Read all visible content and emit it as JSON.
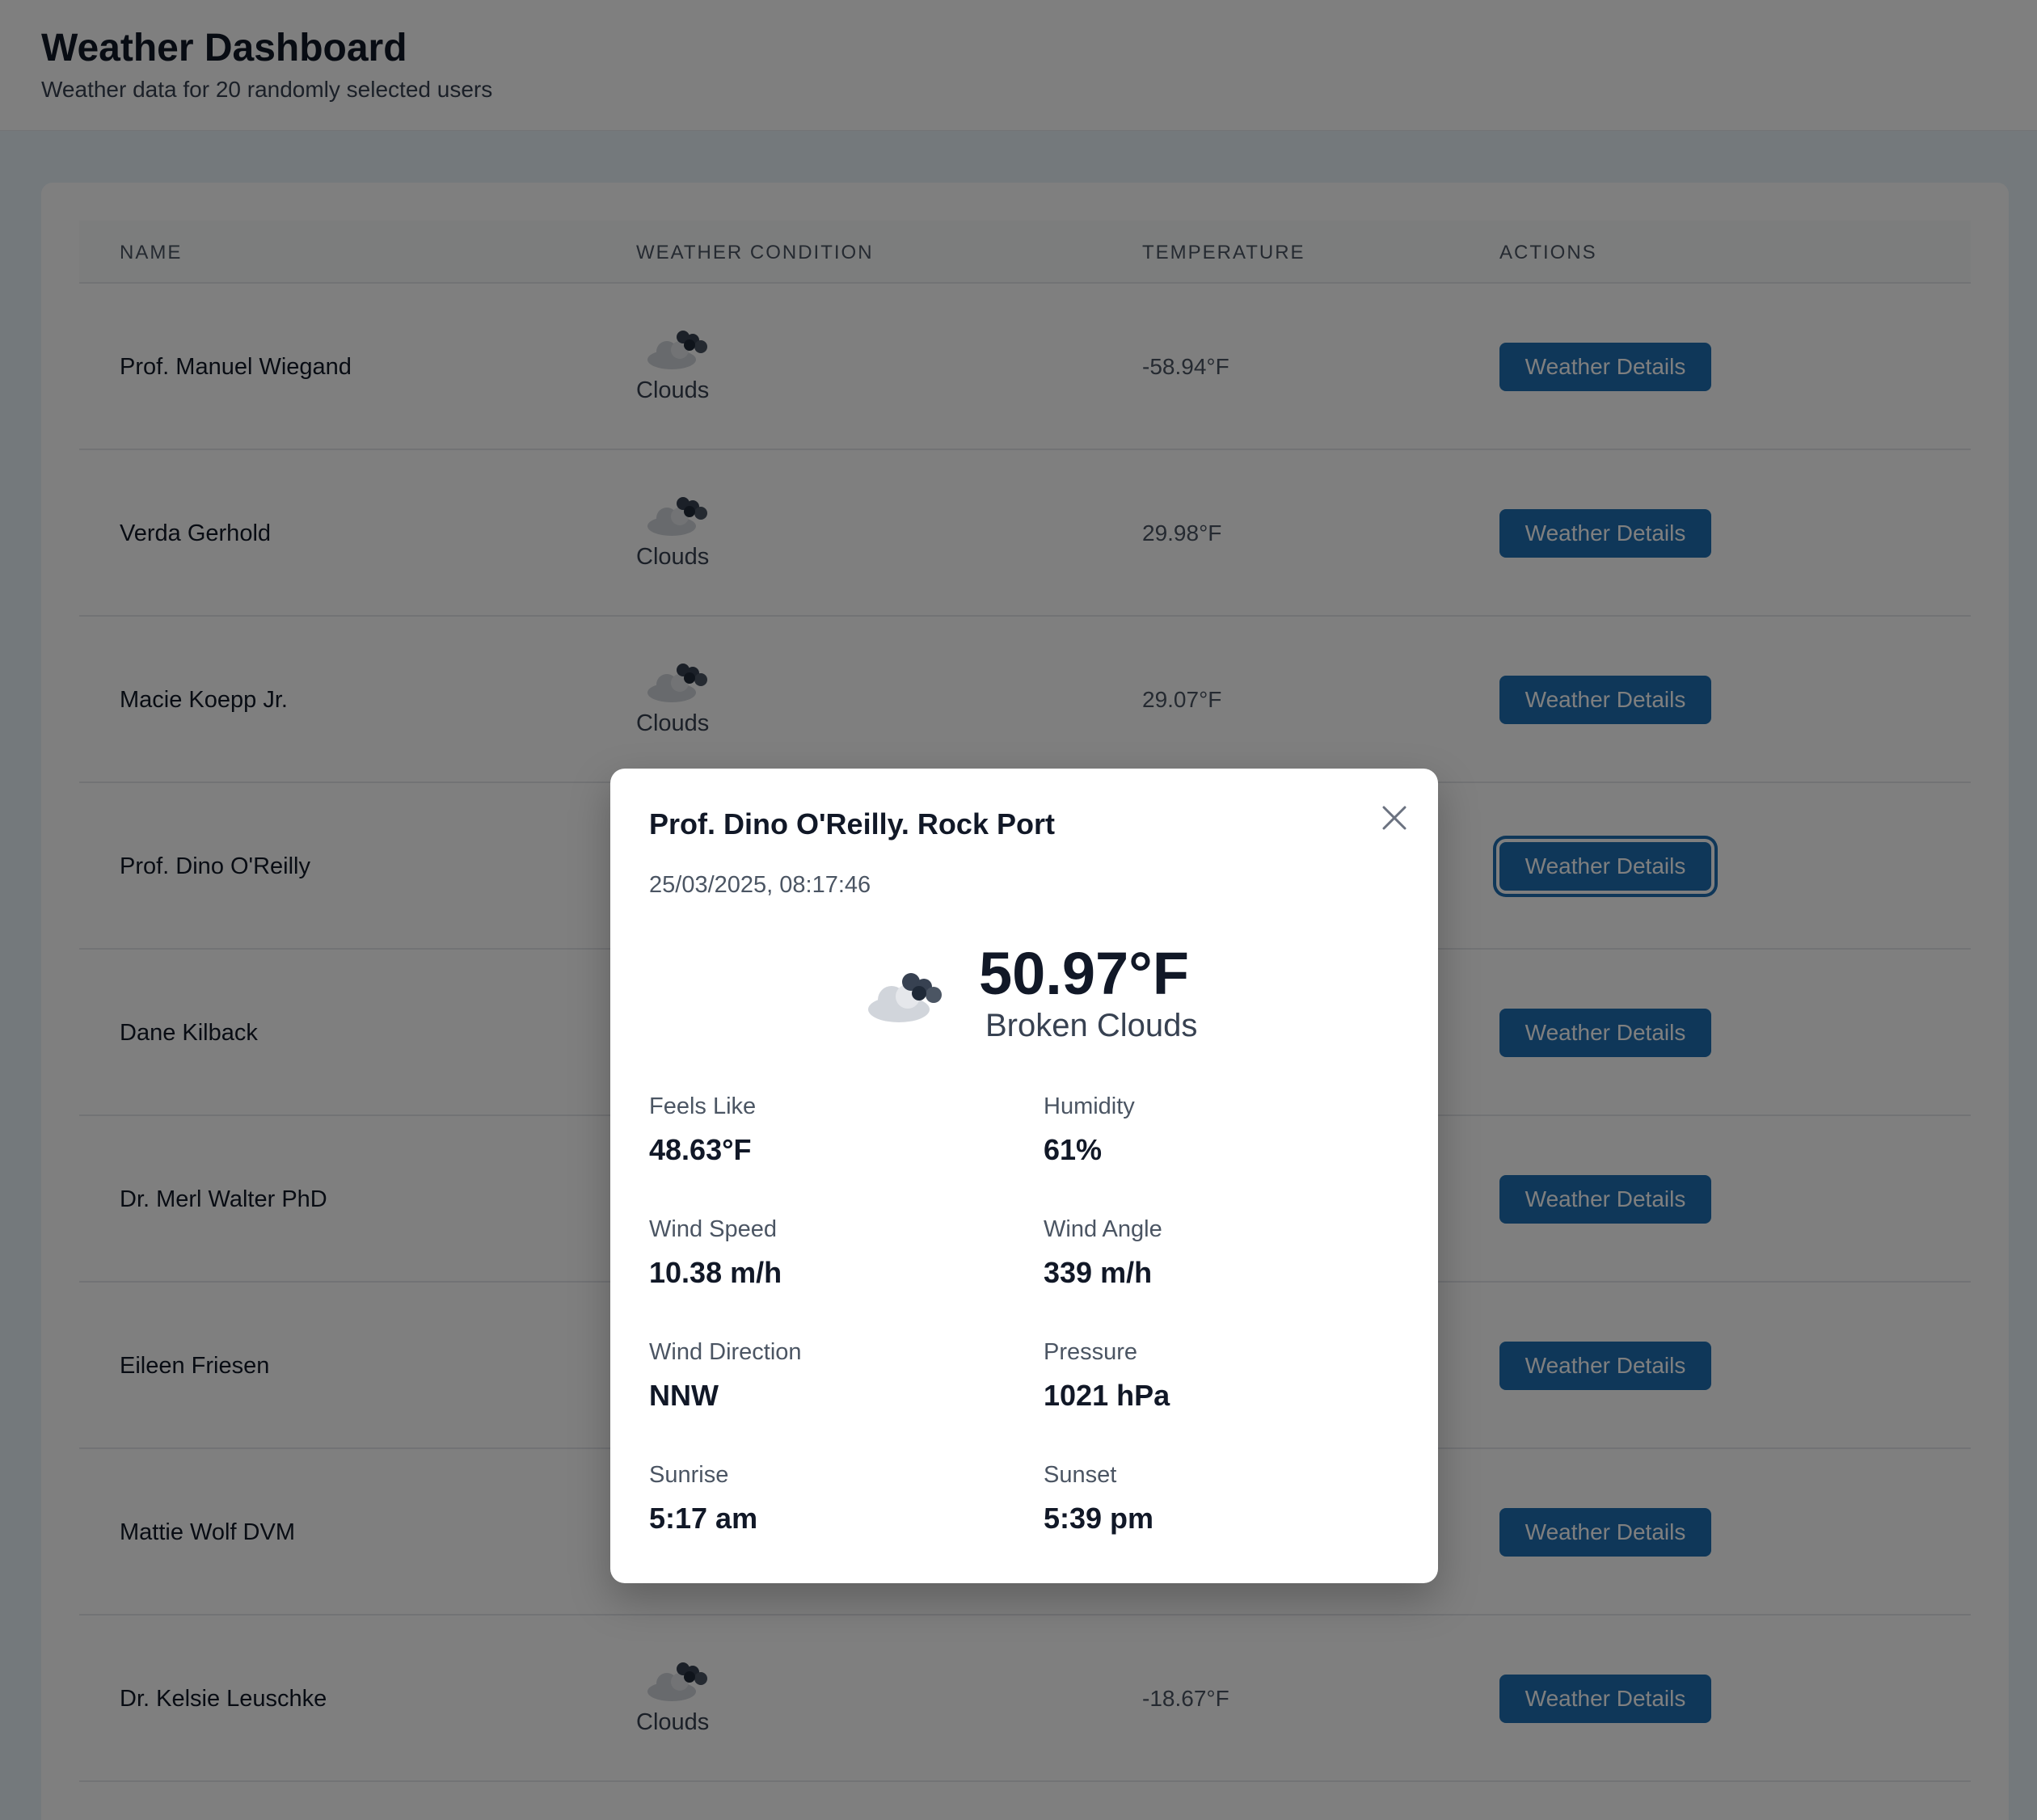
{
  "header": {
    "title": "Weather Dashboard",
    "subtitle": "Weather data for 20 randomly selected users"
  },
  "table": {
    "columns": [
      "NAME",
      "WEATHER CONDITION",
      "TEMPERATURE",
      "ACTIONS"
    ],
    "rows": [
      {
        "name": "Prof. Manuel Wiegand",
        "condition": "Clouds",
        "temperature": "-58.94°F",
        "action": "Weather Details"
      },
      {
        "name": "Verda Gerhold",
        "condition": "Clouds",
        "temperature": "29.98°F",
        "action": "Weather Details"
      },
      {
        "name": "Macie Koepp Jr.",
        "condition": "Clouds",
        "temperature": "29.07°F",
        "action": "Weather Details"
      },
      {
        "name": "Prof. Dino O'Reilly",
        "condition": "",
        "temperature": "",
        "action": "Weather Details"
      },
      {
        "name": "Dane Kilback",
        "condition": "",
        "temperature": "",
        "action": "Weather Details"
      },
      {
        "name": "Dr. Merl Walter PhD",
        "condition": "",
        "temperature": "",
        "action": "Weather Details"
      },
      {
        "name": "Eileen Friesen",
        "condition": "",
        "temperature": "",
        "action": "Weather Details"
      },
      {
        "name": "Mattie Wolf DVM",
        "condition": "",
        "temperature": "",
        "action": "Weather Details"
      },
      {
        "name": "Dr. Kelsie Leuschke",
        "condition": "Clouds",
        "temperature": "-18.67°F",
        "action": "Weather Details"
      }
    ]
  },
  "modal": {
    "title": "Prof. Dino O'Reilly. Rock Port",
    "datetime": "25/03/2025, 08:17:46",
    "temperature": "50.97°F",
    "description": "Broken Clouds",
    "icon": "broken-clouds-icon",
    "close_icon": "close-icon",
    "stats": {
      "feels_like": {
        "label": "Feels Like",
        "value": "48.63°F"
      },
      "humidity": {
        "label": "Humidity",
        "value": "61%"
      },
      "wind_speed": {
        "label": "Wind Speed",
        "value": "10.38 m/h"
      },
      "wind_angle": {
        "label": "Wind Angle",
        "value": "339 m/h"
      },
      "wind_direction": {
        "label": "Wind Direction",
        "value": "NNW"
      },
      "pressure": {
        "label": "Pressure",
        "value": "1021 hPa"
      },
      "sunrise": {
        "label": "Sunrise",
        "value": "5:17 am"
      },
      "sunset": {
        "label": "Sunset",
        "value": "5:39 pm"
      }
    }
  },
  "colors": {
    "button": "#1f6fb2",
    "overlay": "rgba(0,0,0,0.5)"
  }
}
